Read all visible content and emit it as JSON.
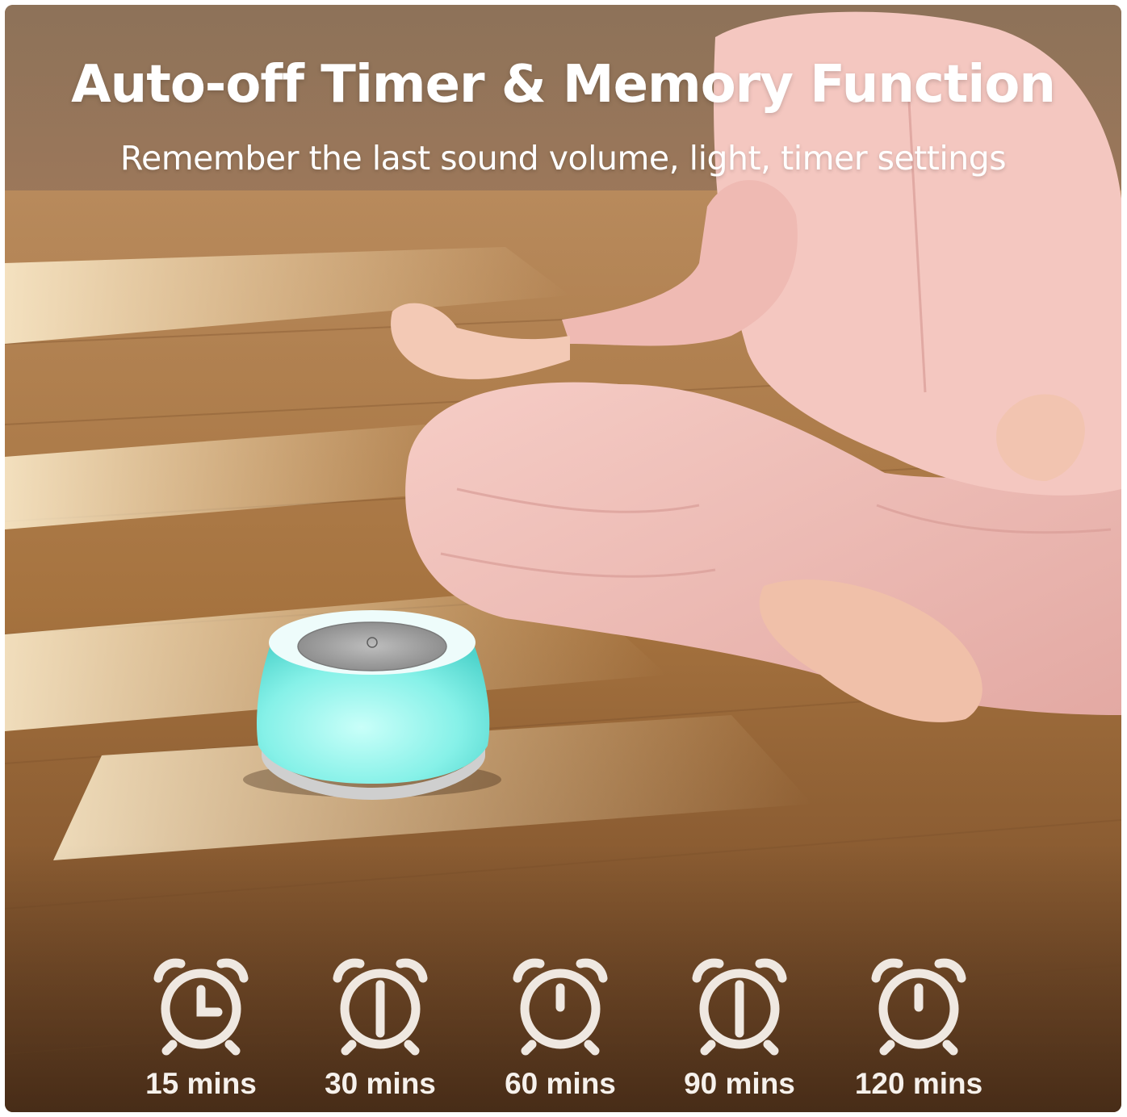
{
  "header": {
    "title": "Auto-off Timer & Memory Function",
    "subtitle": "Remember the last sound volume, light, timer settings"
  },
  "timers": [
    {
      "label": "15 mins",
      "icon": "alarm-clock-icon"
    },
    {
      "label": "30 mins",
      "icon": "alarm-clock-icon"
    },
    {
      "label": "60 mins",
      "icon": "alarm-clock-icon"
    },
    {
      "label": "90 mins",
      "icon": "alarm-clock-icon"
    },
    {
      "label": "120 mins",
      "icon": "alarm-clock-icon"
    }
  ],
  "colors": {
    "text": "#ffffff",
    "icon": "#efe8e1",
    "floor": "#9a6a3c",
    "device_glow": "#7ff3ea",
    "dress": "#f1c2bd"
  }
}
